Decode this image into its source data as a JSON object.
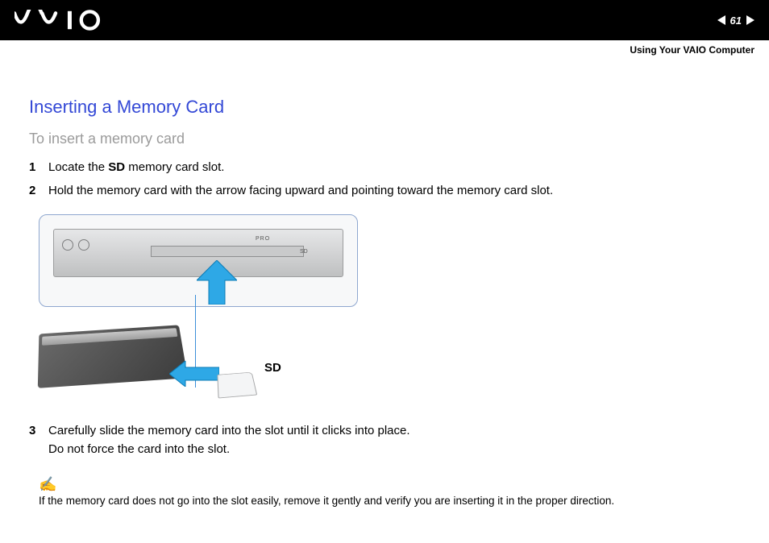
{
  "header": {
    "page_number": "61",
    "section": "Using Your VAIO Computer",
    "logo_alt": "VAIO"
  },
  "content": {
    "title": "Inserting a Memory Card",
    "subtitle": "To insert a memory card",
    "steps": {
      "s1": {
        "num": "1",
        "pre": "Locate the ",
        "bold": "SD",
        "post": " memory card slot."
      },
      "s2": {
        "num": "2",
        "text": "Hold the memory card with the arrow facing upward and pointing toward the memory card slot."
      },
      "s3": {
        "num": "3",
        "line1": "Carefully slide the memory card into the slot until it clicks into place.",
        "line2": "Do not force the card into the slot."
      }
    },
    "figure": {
      "pro_label": "PRO",
      "sd_port_label": "SD",
      "sd_callout": "SD"
    },
    "note": {
      "icon": "✍",
      "text": "If the memory card does not go into the slot easily, remove it gently and verify you are inserting it in the proper direction."
    }
  },
  "colors": {
    "title": "#3348d6",
    "arrow": "#2ea8e6"
  }
}
